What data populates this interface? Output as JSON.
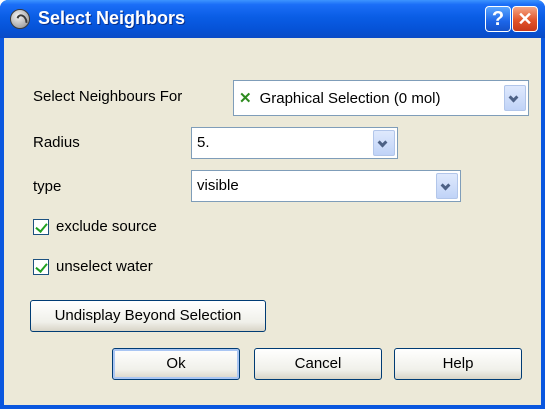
{
  "window": {
    "title": "Select Neighbors",
    "help_glyph": "?",
    "close_glyph": "✕"
  },
  "form": {
    "select_for": {
      "label": "Select Neighbours For",
      "value": "Graphical Selection (0 mol)",
      "icon": "green-x-icon"
    },
    "radius": {
      "label": "Radius",
      "value": "5."
    },
    "type": {
      "label": "type",
      "value": "visible"
    },
    "exclude_source": {
      "label": "exclude source",
      "checked": true
    },
    "unselect_water": {
      "label": "unselect water",
      "checked": true
    },
    "undisplay_button": "Undisplay Beyond Selection"
  },
  "buttons": {
    "ok": "Ok",
    "cancel": "Cancel",
    "help": "Help"
  },
  "colors": {
    "titlebar": "#0a5de5",
    "dialog_bg": "#ece9d8",
    "check": "#21a121"
  }
}
